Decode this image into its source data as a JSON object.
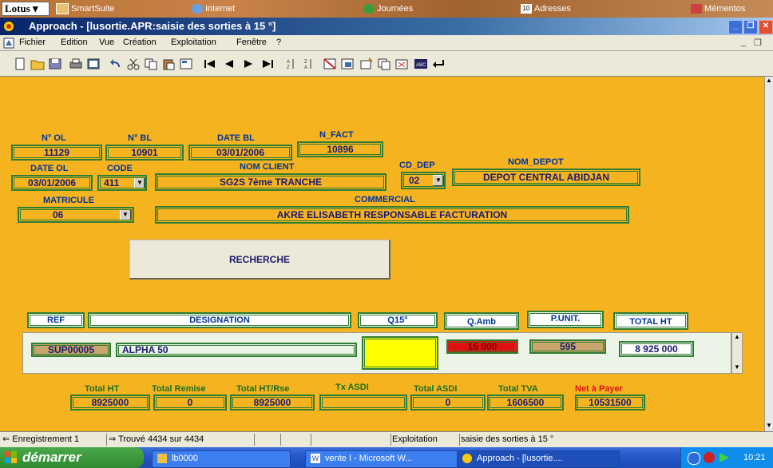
{
  "suitebar": {
    "lotus_label": "Lotus",
    "items": [
      "SmartSuite",
      "Internet",
      "Journées",
      "Adresses",
      "Mémentos"
    ]
  },
  "window": {
    "logo_text": "Lotus SMARTSUITE",
    "title": "Approach - [lusortie.APR:saisie des sorties à 15 °]"
  },
  "menu": [
    "Fichier",
    "Edition",
    "Vue",
    "Création",
    "Exploitation",
    "Fenêtre",
    "?"
  ],
  "form": {
    "labels": {
      "n_ol": "N° OL",
      "n_bl": "N° BL",
      "date_bl": "DATE BL",
      "n_fact": "N_FACT",
      "date_ol": "DATE OL",
      "code": "CODE",
      "nom_client": "NOM CLIENT",
      "cd_dep": "CD_DEP",
      "nom_depot": "NOM_DEPOT",
      "matricule": "MATRICULE",
      "commercial": "COMMERCIAL"
    },
    "values": {
      "n_ol": "11129",
      "n_bl": "10901",
      "date_bl": "03/01/2006",
      "n_fact": "10896",
      "date_ol": "03/01/2006",
      "code": "411",
      "nom_client": "SG2S 7ème TRANCHE",
      "cd_dep": "02",
      "nom_depot": "DEPOT CENTRAL ABIDJAN",
      "matricule": "06",
      "commercial": "AKRE  ELISABETH  RESPONSABLE FACTURATION"
    },
    "recherche_label": "RECHERCHE",
    "columns": {
      "ref": "REF",
      "designation": "DESIGNATION",
      "q15": "Q15°",
      "qamb": "Q.Amb",
      "punit": "P.UNIT.",
      "total_ht": "TOTAL HT"
    },
    "row": {
      "ref": "SUP00005",
      "designation": "ALPHA 50",
      "q15": "",
      "qamb": "15 000",
      "punit": "595",
      "total_ht": "8 925 000"
    },
    "totals": {
      "labels": {
        "total_ht": "Total HT",
        "total_remise": "Total Remise",
        "total_ht_rse": "Total HT/Rse",
        "tx_asdi": "Tx ASDI",
        "total_asdi": "Total ASDI",
        "total_tva": "Total TVA",
        "net_a_payer": "Net à Payer"
      },
      "values": {
        "total_ht": "8925000",
        "total_remise": "0",
        "total_ht_rse": "8925000",
        "tx_asdi": "",
        "total_asdi": "0",
        "total_tva": "1606500",
        "net_a_payer": "10531500"
      }
    }
  },
  "status": {
    "record": "Enregistrement 1",
    "found": "Trouvé 4434 sur 4434",
    "mode": "Exploitation",
    "form_name": "saisie des sorties à 15 °"
  },
  "taskbar": {
    "start": "démarrer",
    "tasks": [
      "lb0000",
      "vente I - Microsoft W...",
      "Approach - [lusortie...."
    ],
    "clock": "10:21"
  },
  "colors": {
    "form_bg": "#f5b320",
    "field_border": "#2e7d32",
    "net_a_payer": "#e01010",
    "qamb_bg": "#e01010",
    "q15_bg": "#ffff00"
  }
}
